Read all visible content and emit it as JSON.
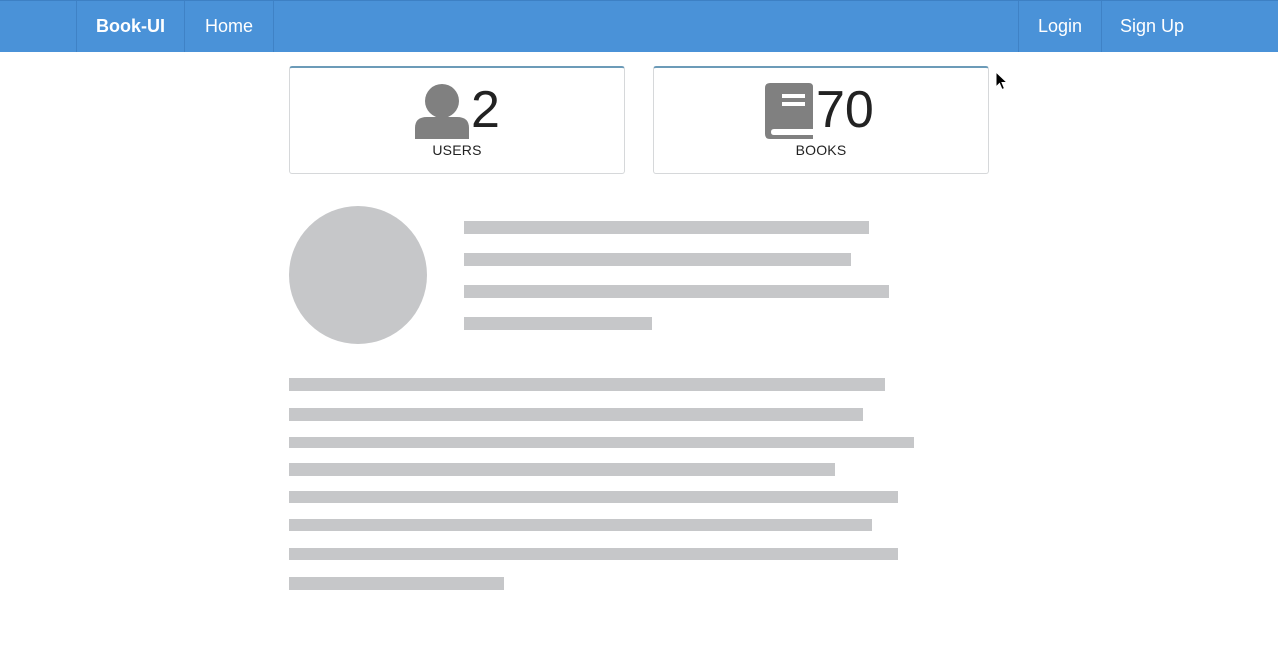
{
  "navbar": {
    "brand": "Book-UI",
    "home": "Home",
    "login": "Login",
    "signup": "Sign Up"
  },
  "stats": {
    "users": {
      "value": "2",
      "label": "USERS",
      "icon": "user-icon"
    },
    "books": {
      "value": "70",
      "label": "BOOKS",
      "icon": "book-icon"
    }
  },
  "colors": {
    "navbar": "#4a92d8",
    "skeleton": "#c6c7c9",
    "icon": "#808080"
  }
}
